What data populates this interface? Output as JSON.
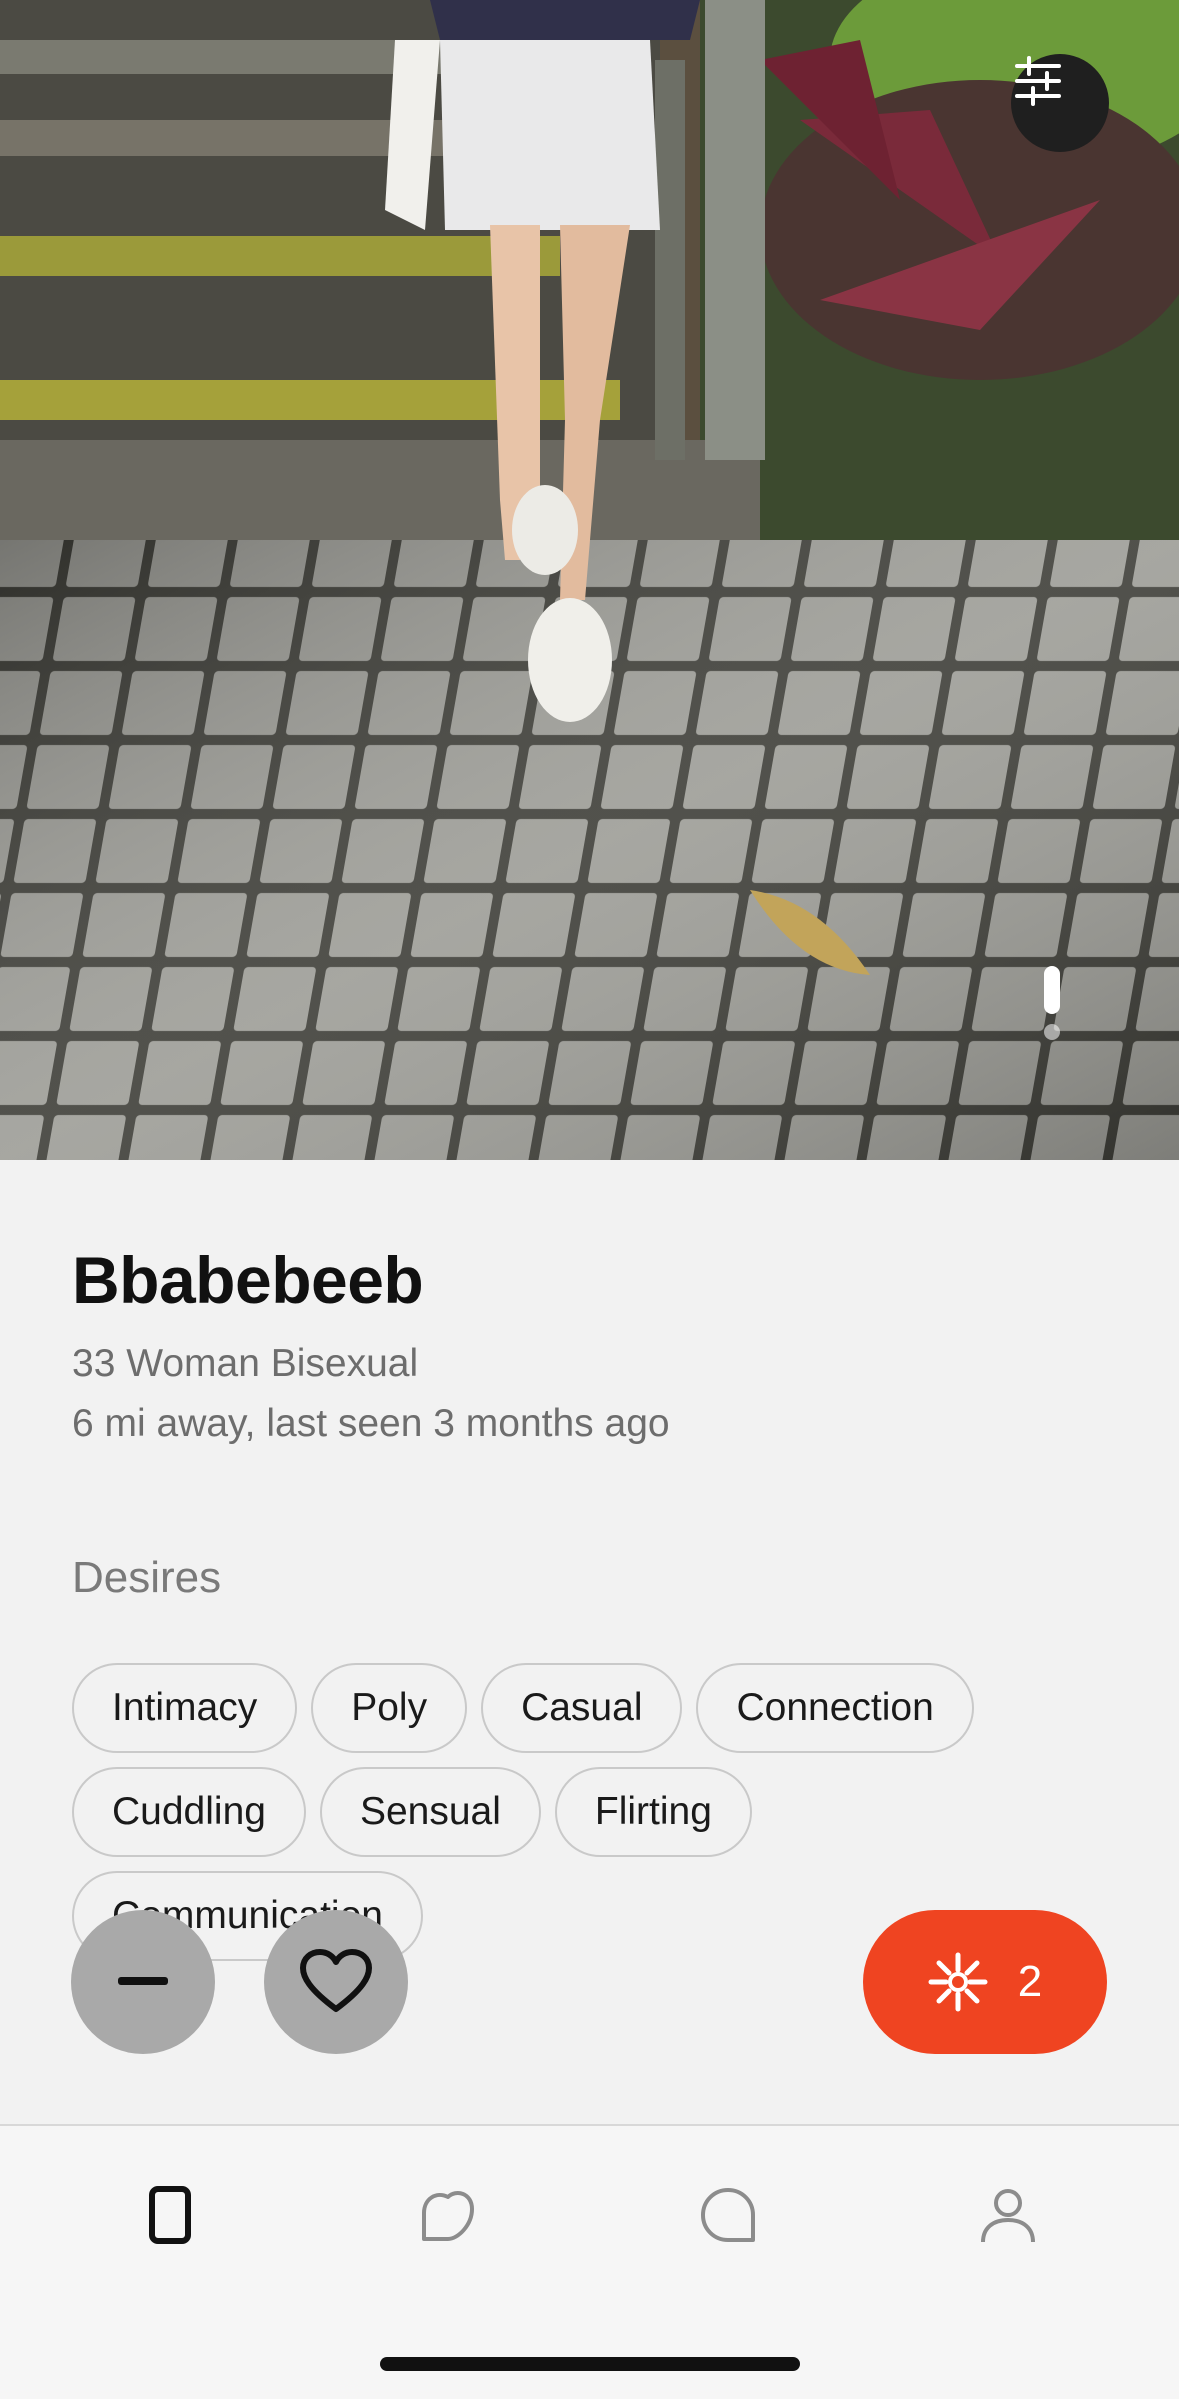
{
  "photo": {
    "pager": {
      "total": 2,
      "active": 1
    }
  },
  "profile": {
    "name": "Bbabebeeb",
    "details": "33 Woman Bisexual",
    "status": "6 mi away, last seen 3 months ago"
  },
  "desires": {
    "title": "Desires",
    "rows": [
      [
        "Intimacy",
        "Poly",
        "Casual",
        "Connection"
      ],
      [
        "Cuddling",
        "Sensual",
        "Flirting"
      ],
      [
        "Communication"
      ]
    ]
  },
  "actions": {
    "pass_icon": "minus-icon",
    "like_icon": "heart-icon",
    "spark_icon": "asterisk-icon",
    "spark_count": "2",
    "spark_color": "#ef4421"
  },
  "nav": {
    "items": [
      {
        "icon": "cards-icon",
        "active": true
      },
      {
        "icon": "likes-icon",
        "active": false
      },
      {
        "icon": "chat-icon",
        "active": false
      },
      {
        "icon": "profile-icon",
        "active": false
      }
    ]
  }
}
